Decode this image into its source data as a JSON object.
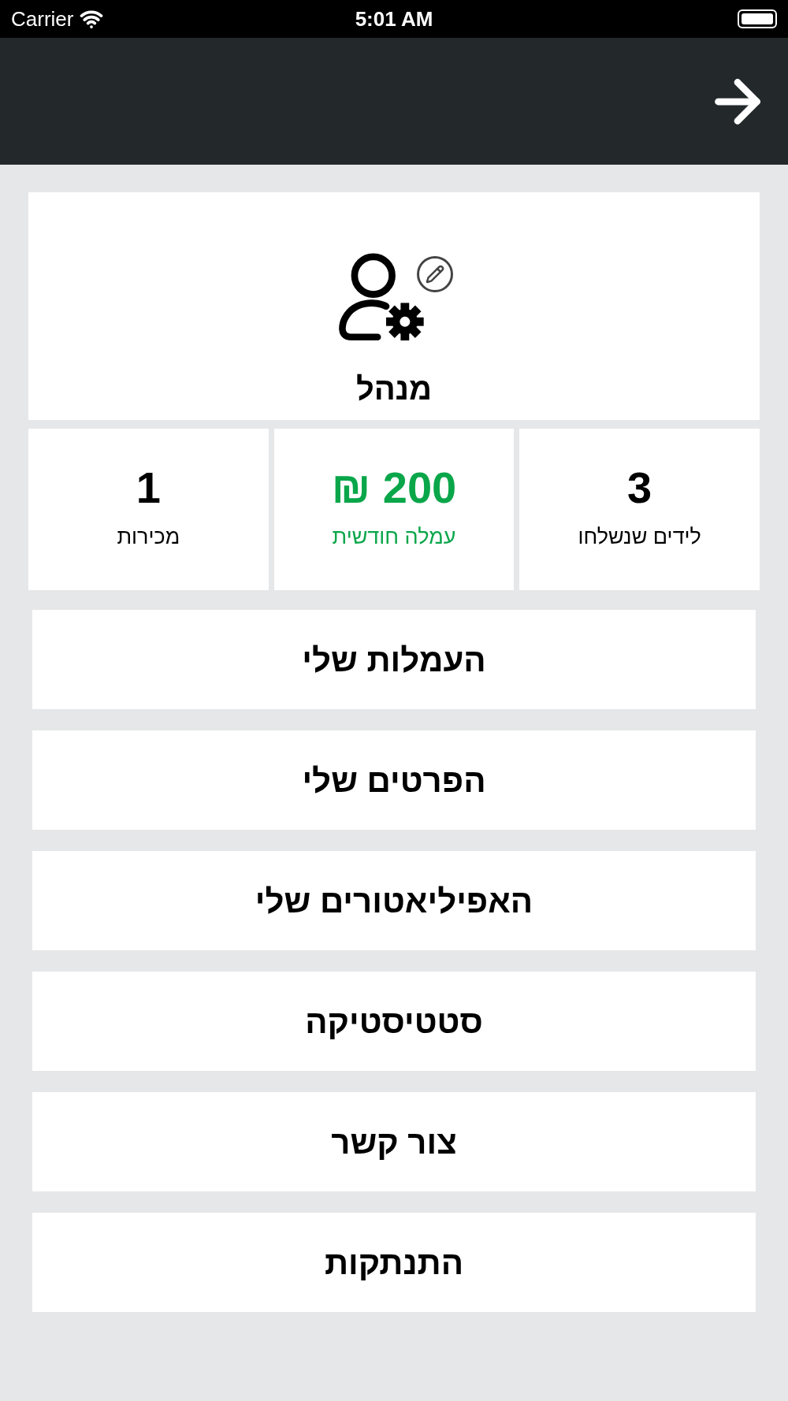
{
  "status_bar": {
    "carrier": "Carrier",
    "time": "5:01 AM"
  },
  "profile": {
    "name": "מנהל"
  },
  "stats": [
    {
      "value": "3",
      "label": "לידים שנשלחו",
      "highlighted": false
    },
    {
      "value": "200 ₪",
      "label": "עמלה חודשית",
      "highlighted": true
    },
    {
      "value": "1",
      "label": "מכירות",
      "highlighted": false
    }
  ],
  "menu": [
    "העמלות שלי",
    "הפרטים שלי",
    "האפיליאטורים שלי",
    "סטטיסטיקה",
    "צור קשר",
    "התנתקות"
  ]
}
